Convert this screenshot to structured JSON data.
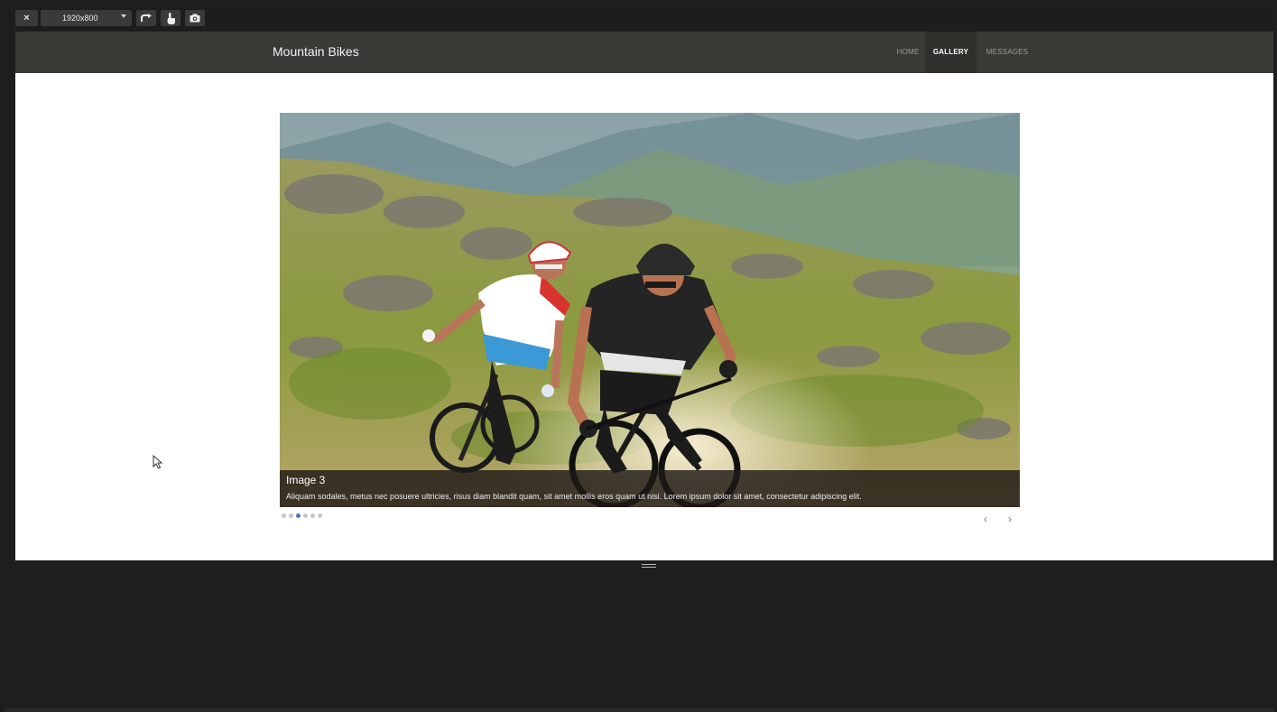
{
  "toolbar": {
    "close_label": "×",
    "resolution_value": "1920x800",
    "icons": [
      "close-icon",
      "chevron-down-icon",
      "rotate-icon",
      "touch-icon",
      "camera-icon"
    ]
  },
  "navbar": {
    "brand": "Mountain Bikes",
    "links": [
      {
        "label": "HOME",
        "active": false
      },
      {
        "label": "GALLERY",
        "active": true
      },
      {
        "label": "MESSAGES",
        "active": false
      }
    ]
  },
  "carousel": {
    "caption_title": "Image 3",
    "caption_text": "Aliquam sodales, metus nec posuere ultricies, risus diam blandit quam, sit amet mollis eros quam ut nisi. Lorem ipsum dolor sit amet, consectetur adipiscing elit.",
    "slide_count": 6,
    "active_index": 2,
    "prev_label": "‹",
    "next_label": "›"
  },
  "colors": {
    "navbar_bg": "#3a3a37",
    "nav_active_bg": "#2f2f2c",
    "indicator_active": "#4a78b5",
    "indicator_inactive": "#c6c6c6",
    "frame_bg": "#1e1e1e"
  }
}
